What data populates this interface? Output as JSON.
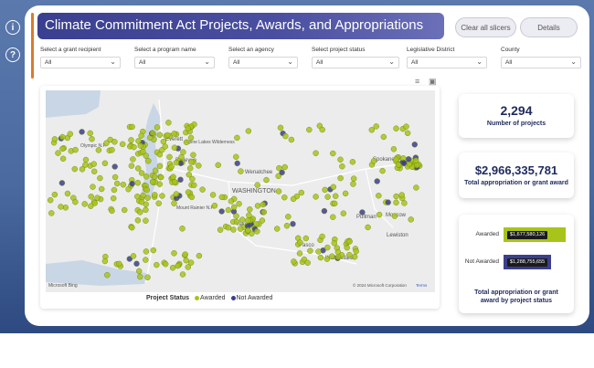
{
  "side_icons": [
    {
      "icon": "info-icon",
      "glyph": "i"
    },
    {
      "icon": "help-icon",
      "glyph": "?"
    }
  ],
  "header": {
    "title": "Climate Commitment Act Projects, Awards, and Appropriations",
    "clear_label": "Clear all slicers",
    "details_label": "Details"
  },
  "slicers": [
    {
      "label": "Select a grant recipient",
      "value": "All"
    },
    {
      "label": "Select a program name",
      "value": "All"
    },
    {
      "label": "Select an agency",
      "value": "All"
    },
    {
      "label": "Select project status",
      "value": "All"
    },
    {
      "label": "Legislative District",
      "value": "All"
    },
    {
      "label": "County",
      "value": "All"
    }
  ],
  "map": {
    "place_labels": [
      {
        "text": "Everett"
      },
      {
        "text": "Olympic N.P."
      },
      {
        "text": "Alpine Lakes Wilderness"
      },
      {
        "text": "Bellevue"
      },
      {
        "text": "Wenatchee"
      },
      {
        "text": "Spokane"
      },
      {
        "text": "WASHINGTON"
      },
      {
        "text": "Mount Rainier N.P."
      },
      {
        "text": "Pullman"
      },
      {
        "text": "Moscow"
      },
      {
        "text": "Yakima"
      },
      {
        "text": "Lewiston"
      },
      {
        "text": "Pasco"
      },
      {
        "text": "Walla Walla"
      }
    ],
    "credit": "Microsoft Bing",
    "copyright": "© 2024 Microsoft Corporation",
    "terms": "Terms",
    "land_color": "#ececec",
    "water_color": "#c8d6e6"
  },
  "legend": {
    "title": "Project Status",
    "items": [
      {
        "label": "Awarded",
        "color": "#a8c41a"
      },
      {
        "label": "Not Awarded",
        "color": "#3b3f8c"
      }
    ]
  },
  "kpis": {
    "projects_value": "2,294",
    "projects_label": "Number of projects",
    "total_value": "$2,966,335,781",
    "total_label": "Total appropriation or grant award"
  },
  "bar_card": {
    "title": "Total appropriation or grant award by project status",
    "bars": [
      {
        "label": "Awarded",
        "value_text": "$1,677,580,126",
        "value": 1677580126,
        "color": "#a8c41a"
      },
      {
        "label": "Not Awarded",
        "value_text": "$1,288,755,655",
        "value": 1288755655,
        "color": "#3b3f8c"
      }
    ]
  }
}
